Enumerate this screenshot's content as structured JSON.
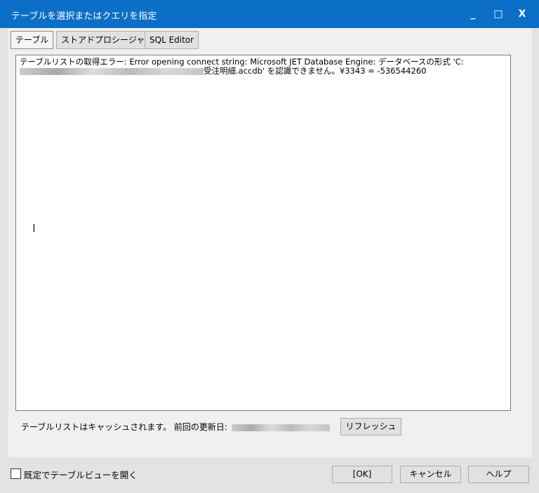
{
  "window": {
    "title": "テーブルを選択またはクエリを指定",
    "minimize": "_",
    "maximize": "□",
    "close": "X"
  },
  "tabs": [
    {
      "label": "テーブル",
      "active": true
    },
    {
      "label": "ストアドプロシージャ",
      "active": false
    },
    {
      "label": "SQL Editor",
      "active": false
    }
  ],
  "message": {
    "line1": "テーブルリストの取得エラー: Error opening connect string: Microsoft JET Database Engine: データベースの形式 'C:",
    "line2_suffix": "受注明細.accdb' を認識できません。¥3343 = -536544260"
  },
  "status": {
    "cache_text": "テーブルリストはキャッシュされます。 前回の更新日:",
    "refresh_label": "リフレッシュ"
  },
  "footer": {
    "checkbox_label": "既定でテーブルビューを開く",
    "checked": false,
    "ok_label": "[OK]",
    "cancel_label": "キャンセル",
    "help_label": "ヘルプ"
  }
}
